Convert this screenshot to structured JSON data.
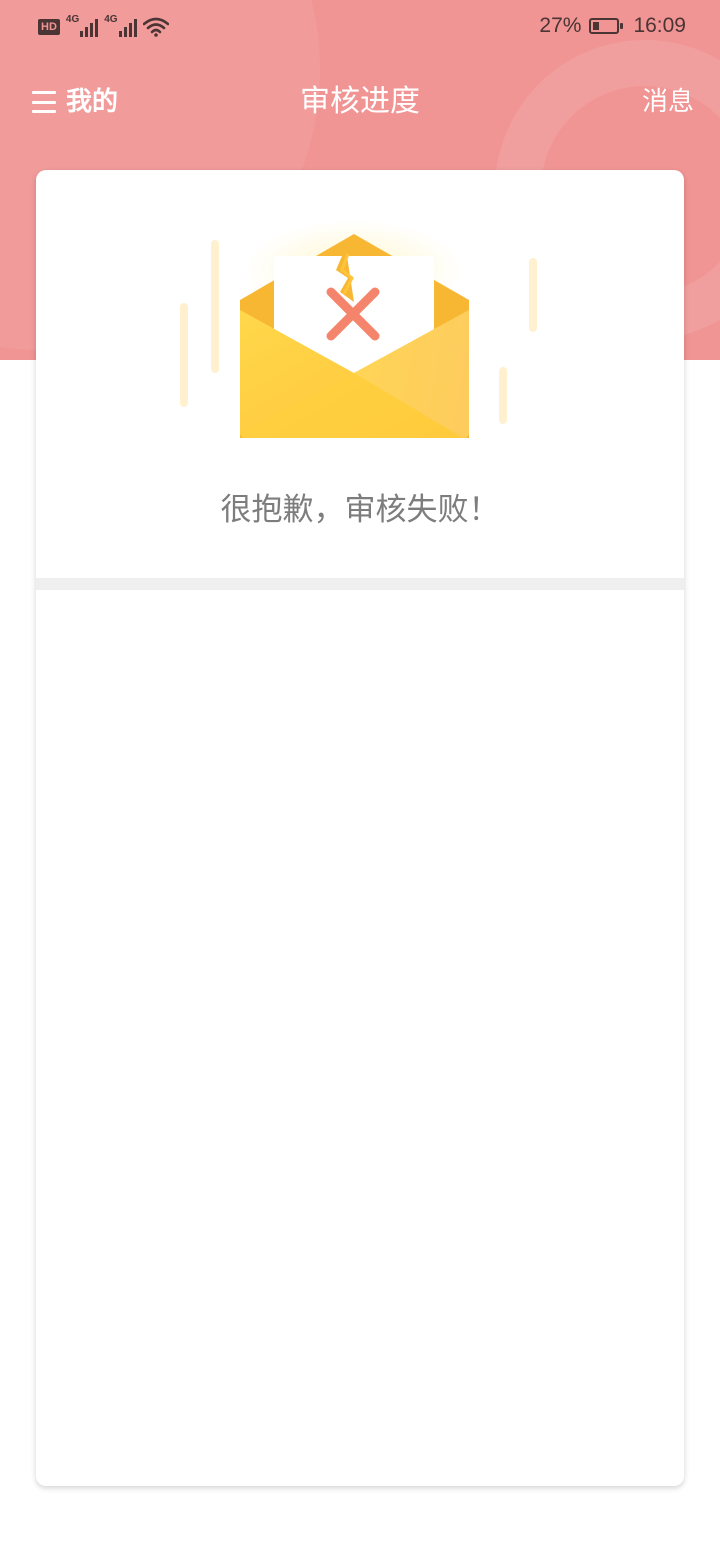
{
  "status_bar": {
    "hd_label": "HD",
    "network_1": "4G",
    "network_2": "4G",
    "battery_percent": "27%",
    "battery_level": 0.27,
    "time": "16:09"
  },
  "nav": {
    "left_label": "我的",
    "title": "审核进度",
    "right_label": "消息"
  },
  "result": {
    "message": "很抱歉，审核失败！"
  },
  "colors": {
    "header_bg": "#f09594",
    "envelope": "#ffcf3d",
    "cross": "#f4856c",
    "message_text": "#7d7d7d"
  },
  "icons": {
    "menu": "menu-icon",
    "illustration": "failed-envelope-icon"
  }
}
